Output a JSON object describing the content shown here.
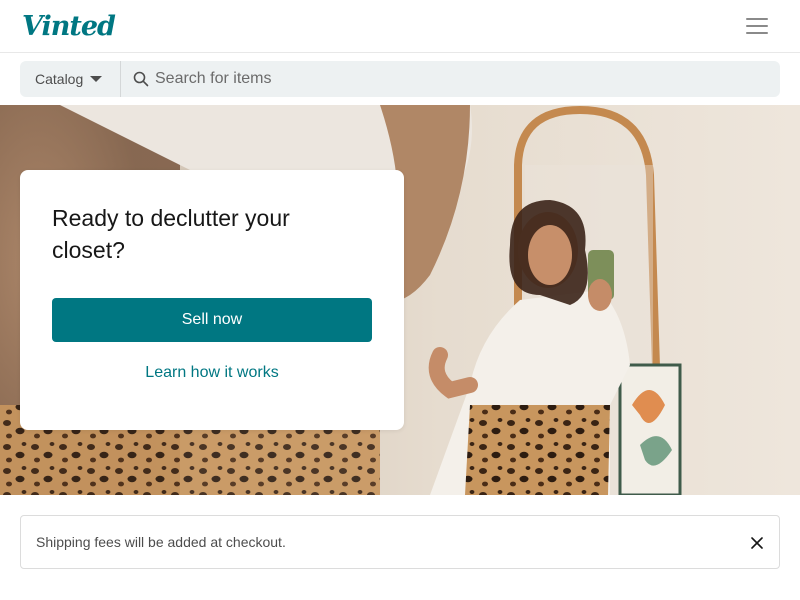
{
  "header": {
    "logo_text": "Vinted",
    "menu_icon": "hamburger-menu-icon"
  },
  "search": {
    "catalog_label": "Catalog",
    "placeholder": "Search for items",
    "value": "",
    "icon": "search-icon"
  },
  "hero": {
    "title": "Ready to declutter your closet?",
    "sell_button": "Sell now",
    "learn_link": "Learn how it works"
  },
  "notice": {
    "text": "Shipping fees will be added at checkout.",
    "close_icon": "close-icon"
  },
  "colors": {
    "brand": "#007782",
    "search_bg": "#edf1f2"
  }
}
